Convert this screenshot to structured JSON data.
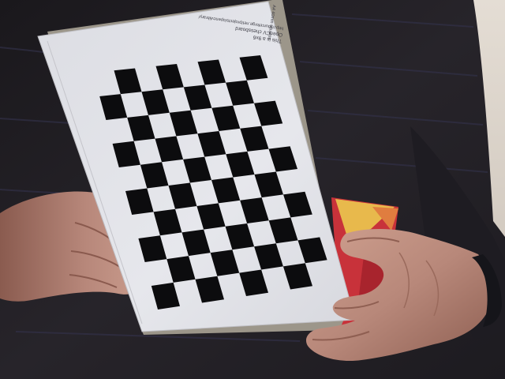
{
  "photo": {
    "subject": "OpenCV checkerboard calibration pattern held in two hands",
    "board": {
      "columns": 9,
      "rows": 6,
      "square_color": "#0c0c0e",
      "paper_color": "#e3e4ea"
    },
    "printed_text": {
      "line1": "This is a 9x6",
      "line2": "OpenCV chessboard",
      "line3": "http://sourceforge.net/projects/opencvlibrary/",
      "side": "A4 40mm squares"
    },
    "colors": {
      "sweater": "#242127",
      "sweater_stripe": "#33334a",
      "background": "#d9d2c9",
      "skin": "#b98a7a",
      "box_red": "#c8323a",
      "box_yellow": "#e6b84a"
    }
  }
}
